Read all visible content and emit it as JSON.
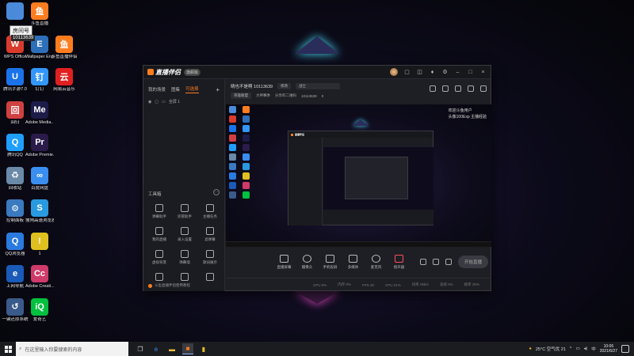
{
  "desktop": {
    "room_badge": "房间号",
    "room_number": "10113639",
    "icons": [
      {
        "label": "",
        "color": "#4a8ad8",
        "glyph": "",
        "col": 0,
        "row": 0
      },
      {
        "label": "斗鱼直播",
        "color": "#ff7d1f",
        "glyph": "鱼",
        "col": 1,
        "row": 0
      },
      {
        "label": "WPS Office",
        "color": "#d83b2c",
        "glyph": "W",
        "col": 0,
        "row": 1
      },
      {
        "label": "Wallpaper Engine:...",
        "color": "#2d6fb8",
        "glyph": "E",
        "col": 1,
        "row": 1
      },
      {
        "label": "斗鱼直播伴侣",
        "color": "#ff7d1f",
        "glyph": "鱼",
        "col": 2,
        "row": 1
      },
      {
        "label": "腾讯手游7.0",
        "color": "#1a73e8",
        "glyph": "U",
        "col": 0,
        "row": 2
      },
      {
        "label": "钉钉",
        "color": "#3296fa",
        "glyph": "钉",
        "col": 1,
        "row": 2
      },
      {
        "label": "网易云音乐",
        "color": "#e02020",
        "glyph": "云",
        "col": 2,
        "row": 2
      },
      {
        "label": "回归",
        "color": "#d04040",
        "glyph": "回",
        "col": 0,
        "row": 3
      },
      {
        "label": "Adobe Media...",
        "color": "#1d1b48",
        "glyph": "Me",
        "col": 1,
        "row": 3
      },
      {
        "label": "腾讯QQ",
        "color": "#1e9fff",
        "glyph": "Q",
        "col": 0,
        "row": 4
      },
      {
        "label": "Adobe Premie...",
        "color": "#2a1b4a",
        "glyph": "Pr",
        "col": 1,
        "row": 4
      },
      {
        "label": "回收站",
        "color": "#6a8aa8",
        "glyph": "♻",
        "col": 0,
        "row": 5
      },
      {
        "label": "百度网盘",
        "color": "#3a8ef0",
        "glyph": "∞",
        "col": 1,
        "row": 5
      },
      {
        "label": "控制面板",
        "color": "#3a7ac0",
        "glyph": "⚙",
        "col": 0,
        "row": 6
      },
      {
        "label": "搜狗高速浏览器",
        "color": "#2a9ae0",
        "glyph": "S",
        "col": 1,
        "row": 6
      },
      {
        "label": "QQ浏览器",
        "color": "#2a7ae0",
        "glyph": "Q",
        "col": 0,
        "row": 7
      },
      {
        "label": "1",
        "color": "#e0c020",
        "glyph": "!",
        "col": 1,
        "row": 7
      },
      {
        "label": "上网导航",
        "color": "#1a5ab8",
        "glyph": "e",
        "col": 0,
        "row": 8
      },
      {
        "label": "Adobe Creati...",
        "color": "#d03a6a",
        "glyph": "Cc",
        "col": 1,
        "row": 8
      },
      {
        "label": "一键还原系统",
        "color": "#3a5a8a",
        "glyph": "↺",
        "col": 0,
        "row": 9
      },
      {
        "label": "爱奇艺",
        "color": "#00c040",
        "glyph": "iQ",
        "col": 1,
        "row": 9
      }
    ]
  },
  "app": {
    "logo": "直播伴侣",
    "version_badge": "旗舰版",
    "tabs": [
      "我的场景",
      "图集",
      "可选择"
    ],
    "scene_label": "全屏 1",
    "toolbox_title": "工具箱",
    "tools": [
      "弹幕助手",
      "房管助手",
      "主播任务",
      "我的直播",
      "录入设置",
      "滤弹幕",
      "虚拟背景",
      "弹幕墙",
      "歌词展示",
      "",
      "",
      ""
    ],
    "footer_text": "斗鱼直播伴侣使用教程",
    "room": {
      "title": "晴也不是啊 10113639",
      "edit": "修改",
      "category": "战士",
      "tag1": "英雄联盟",
      "tag2": "大神赛季",
      "online_label": "分享的二维码",
      "fans": "10113639",
      "heat": "0"
    },
    "preview_side_text": [
      "欢迎斗鱼用户",
      "头像100Exp 主播经验"
    ],
    "controls": [
      "直播屏幕",
      "摄像头",
      "手机投屏",
      "多媒体",
      "麦克风",
      "扬声器"
    ],
    "start_button": "开始直播",
    "status": [
      "CPU 0%",
      "内存 0%",
      "FPS 30",
      "CPU 21%",
      "码率 0kb/s",
      "丢帧 0%",
      "帧率 25%"
    ]
  },
  "taskbar": {
    "search_placeholder": "在这里输入你要搜索的内容",
    "weather": "25°C 空气优 21",
    "time": "10:06",
    "date": "2021/6/27"
  },
  "colors": {
    "accent": "#ff7d1f"
  }
}
